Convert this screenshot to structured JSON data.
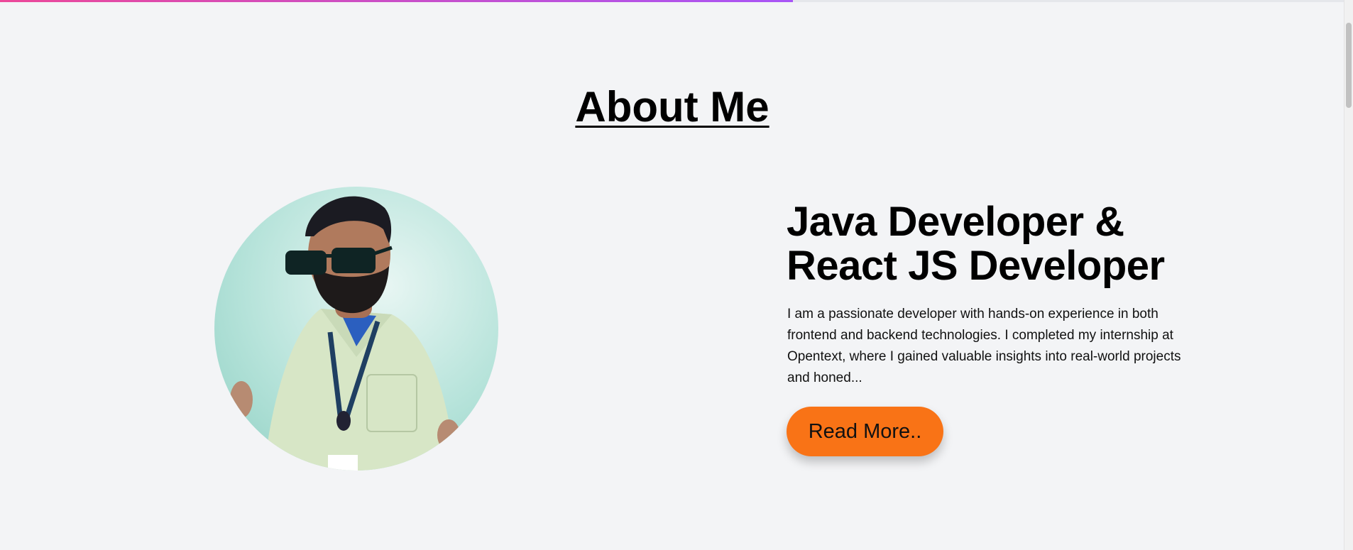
{
  "progress_bar": {
    "value_percent": 59,
    "gradient_start": "#ec4899",
    "gradient_end": "#a855f7"
  },
  "about": {
    "heading": "About Me",
    "role_title": "Java Developer & React JS Developer",
    "bio": "I am a passionate developer with hands-on experience in both frontend and backend technologies. I completed my internship at Opentext, where I gained valuable insights into real-world projects and honed...",
    "read_more_label": "Read More.."
  },
  "colors": {
    "page_background": "#f3f4f6",
    "button_accent": "#f97316",
    "text": "#000000"
  },
  "icons": {
    "profile_photo": "profile-photo"
  }
}
